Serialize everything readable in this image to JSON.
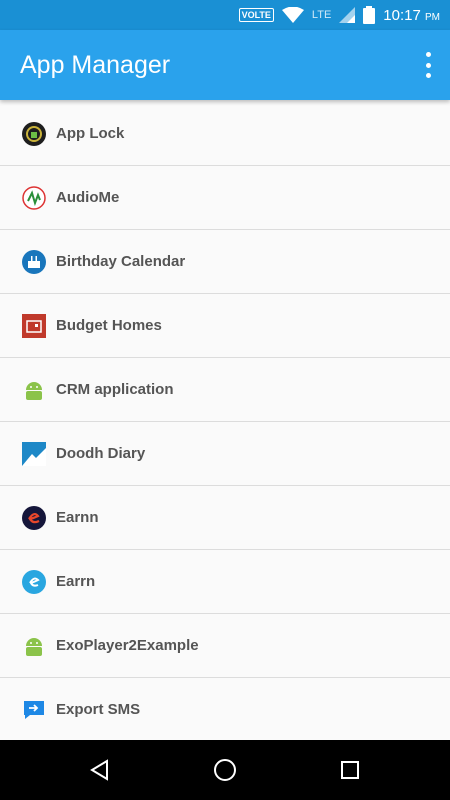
{
  "status_bar": {
    "volte": "VOLTE",
    "network": "LTE",
    "time": "10:17",
    "ampm": "PM"
  },
  "app_bar": {
    "title": "App Manager",
    "menu_icon": "more-vert-icon"
  },
  "apps": [
    {
      "name": "App Lock",
      "icon": "app-lock-icon"
    },
    {
      "name": "AudioMe",
      "icon": "audiome-icon"
    },
    {
      "name": "Birthday Calendar",
      "icon": "birthday-calendar-icon"
    },
    {
      "name": "Budget Homes",
      "icon": "budget-homes-icon"
    },
    {
      "name": "CRM application",
      "icon": "android-icon"
    },
    {
      "name": "Doodh Diary",
      "icon": "doodh-diary-icon"
    },
    {
      "name": "Earnn",
      "icon": "earnn-dark-icon"
    },
    {
      "name": "Earrn",
      "icon": "earrn-icon"
    },
    {
      "name": "ExoPlayer2Example",
      "icon": "android-icon"
    },
    {
      "name": "Export SMS",
      "icon": "export-sms-icon"
    }
  ],
  "nav_bar": {
    "back": "back-icon",
    "home": "home-icon",
    "recents": "recents-icon"
  },
  "colors": {
    "status_bar": "#1a90d4",
    "app_bar": "#2aa2ec",
    "background": "#fafafa",
    "label": "#555555"
  }
}
